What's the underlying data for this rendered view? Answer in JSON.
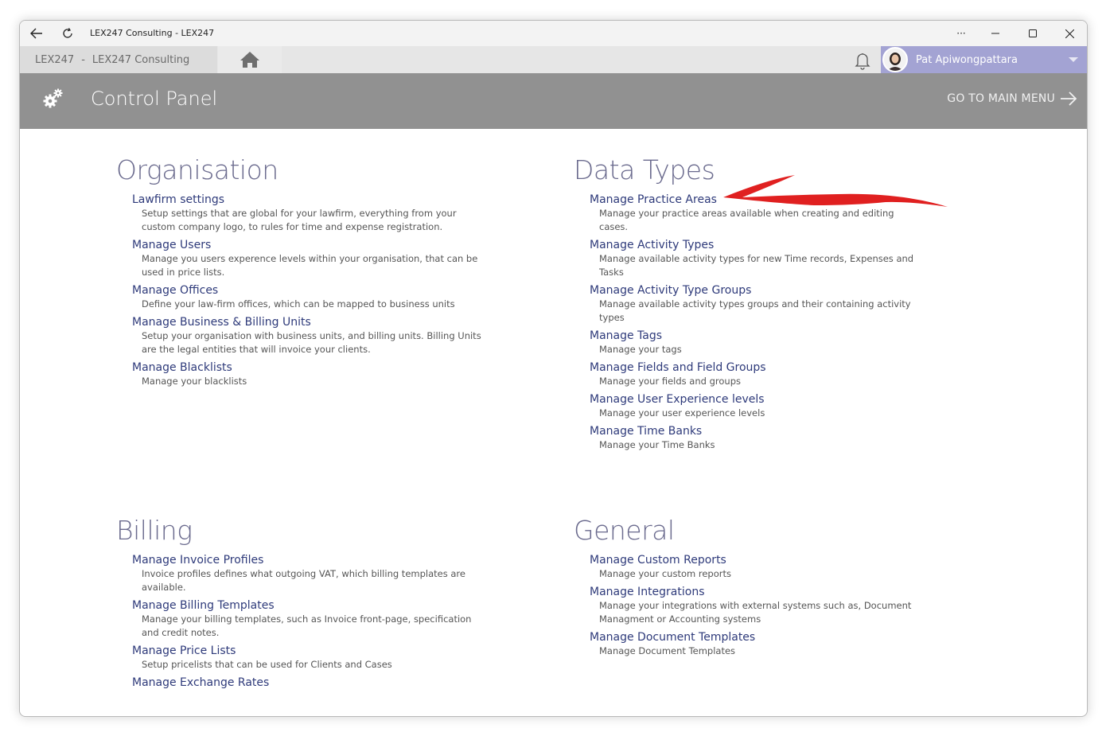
{
  "window": {
    "title": "LEX247 Consulting - LEX247",
    "more_label": "···"
  },
  "appbar": {
    "crumb_app": "LEX247",
    "crumb_sep": "-",
    "crumb_company": "LEX247 Consulting",
    "user_name": "Pat Apiwongpattara"
  },
  "header": {
    "title": "Control Panel",
    "main_menu_label": "GO TO MAIN MENU"
  },
  "sections": {
    "organisation": {
      "title": "Organisation",
      "items": [
        {
          "title": "Lawfirm settings",
          "desc": "Setup settings that are global for your lawfirm, everything from your custom company logo, to rules for time and expense registration."
        },
        {
          "title": "Manage Users",
          "desc": "Manage you users experence levels within your organisation, that can be used in price lists."
        },
        {
          "title": "Manage Offices",
          "desc": "Define your law-firm offices, which can be mapped to business units"
        },
        {
          "title": "Manage Business & Billing Units",
          "desc": "Setup your organisation with business units, and billing units. Billing Units are the legal entities that will invoice your clients."
        },
        {
          "title": "Manage Blacklists",
          "desc": "Manage your blacklists"
        }
      ]
    },
    "data_types": {
      "title": "Data Types",
      "items": [
        {
          "title": "Manage Practice Areas",
          "desc": "Manage your practice areas available when creating and editing cases."
        },
        {
          "title": "Manage Activity Types",
          "desc": "Manage available activity types for new Time records, Expenses and Tasks"
        },
        {
          "title": "Manage Activity Type Groups",
          "desc": "Manage available activity types groups and their containing activity types"
        },
        {
          "title": "Manage Tags",
          "desc": "Manage your tags"
        },
        {
          "title": "Manage Fields and Field Groups",
          "desc": "Manage your fields and groups"
        },
        {
          "title": "Manage User Experience levels",
          "desc": "Manage your user experience levels"
        },
        {
          "title": "Manage Time Banks",
          "desc": "Manage your Time Banks"
        }
      ]
    },
    "billing": {
      "title": "Billing",
      "items": [
        {
          "title": "Manage Invoice Profiles",
          "desc": "Invoice profiles defines what outgoing VAT, which billing templates are available."
        },
        {
          "title": "Manage Billing Templates",
          "desc": "Manage your billing templates, such as Invoice front-page, specification and credit notes."
        },
        {
          "title": "Manage Price Lists",
          "desc": "Setup pricelists that can be used for Clients and Cases"
        },
        {
          "title": "Manage Exchange Rates",
          "desc": ""
        }
      ]
    },
    "general": {
      "title": "General",
      "items": [
        {
          "title": "Manage Custom Reports",
          "desc": "Manage your custom reports"
        },
        {
          "title": "Manage Integrations",
          "desc": "Manage your integrations with external systems such as, Document Managment or Accounting systems"
        },
        {
          "title": "Manage Document Templates",
          "desc": "Manage Document Templates"
        }
      ]
    }
  },
  "colors": {
    "header_bg": "#919191",
    "user_bg": "#a3a3d3",
    "section_title": "#6b6b8e",
    "link": "#2e3a7a",
    "annotation_arrow": "#e02020"
  }
}
